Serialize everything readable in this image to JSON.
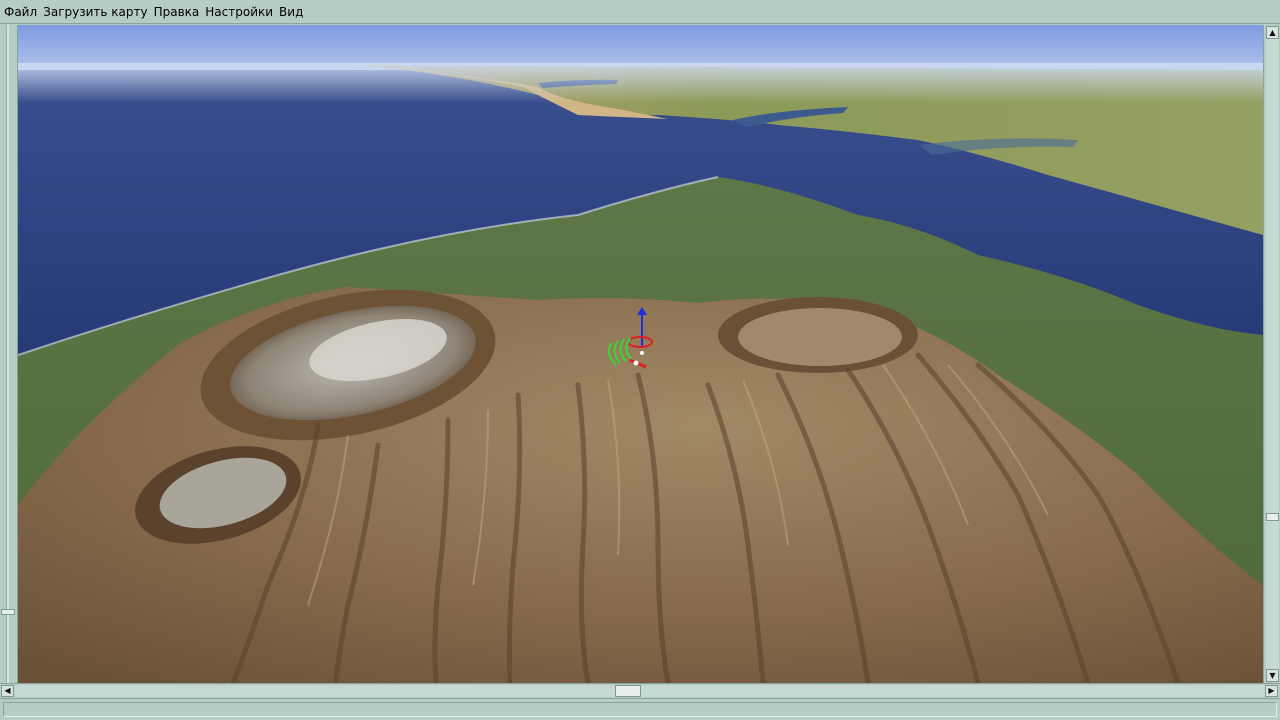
{
  "menu": {
    "items": [
      {
        "label": "Файл"
      },
      {
        "label": "Загрузить карту"
      },
      {
        "label": "Правка"
      },
      {
        "label": "Настройки"
      },
      {
        "label": "Вид"
      }
    ]
  },
  "viewport": {
    "scene": "3d-terrain-view",
    "colors": {
      "sky_top": "#8aa3e0",
      "sky_bottom": "#c9d7f2",
      "sea": "#2b3f7e",
      "land_far": "#8f9a5c",
      "land_green": "#566f3c",
      "volcano": "#8d7453",
      "marker_green": "#39d639",
      "marker_red": "#e02020",
      "marker_blue": "#2030e0"
    }
  },
  "scrollbars": {
    "vertical_position": 0.75,
    "horizontal_position": 0.5
  },
  "statusbar": {
    "text": ""
  }
}
